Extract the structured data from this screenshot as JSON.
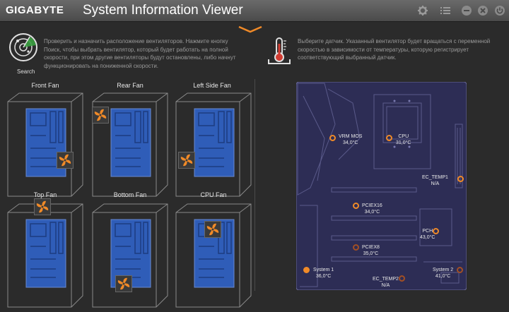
{
  "window": {
    "brand": "GIGABYTE",
    "title": "System Information Viewer",
    "controls": [
      "gear-icon",
      "list-icon",
      "minimize-icon",
      "close-icon",
      "power-icon"
    ]
  },
  "search": {
    "label": "Search",
    "description": "Проверить и назначить расположение вентиляторов. Нажмите кнопку Поиск, чтобы выбрать вентилятор, который будет работать на полной скорости, при этом другие вентиляторы будут остановлены, либо начнут функционировать на пониженной скорости."
  },
  "sensor_panel": {
    "description": "Выберите датчик.  Указанный вентилятор будет вращаться с переменной скоростью в зависимости от температуры, которую регистрирует соответствующий выбранный датчик."
  },
  "fans": [
    {
      "label": "Front Fan"
    },
    {
      "label": "Rear Fan"
    },
    {
      "label": "Left Side Fan"
    },
    {
      "label": "Top Fan"
    },
    {
      "label": "Bottom Fan"
    },
    {
      "label": "CPU Fan"
    }
  ],
  "sensors": [
    {
      "name": "VRM MOS",
      "value": "34,0°C",
      "state": "active"
    },
    {
      "name": "CPU",
      "value": "31,0°C",
      "state": "active"
    },
    {
      "name": "EC_TEMP1",
      "value": "N/A",
      "state": "active"
    },
    {
      "name": "PCIEX16",
      "value": "34,0°C",
      "state": "active"
    },
    {
      "name": "PCH",
      "value": "43,0°C",
      "state": "active"
    },
    {
      "name": "PCIEX8",
      "value": "35,0°C",
      "state": "dim"
    },
    {
      "name": "System 1",
      "value": "36,0°C",
      "state": "selected"
    },
    {
      "name": "EC_TEMP2",
      "value": "N/A",
      "state": "dim"
    },
    {
      "name": "System 2",
      "value": "41,0°C",
      "state": "dim"
    }
  ],
  "colors": {
    "accent": "#f08a28",
    "board": "#2d2d55",
    "case_blue": "#2f5db8"
  }
}
